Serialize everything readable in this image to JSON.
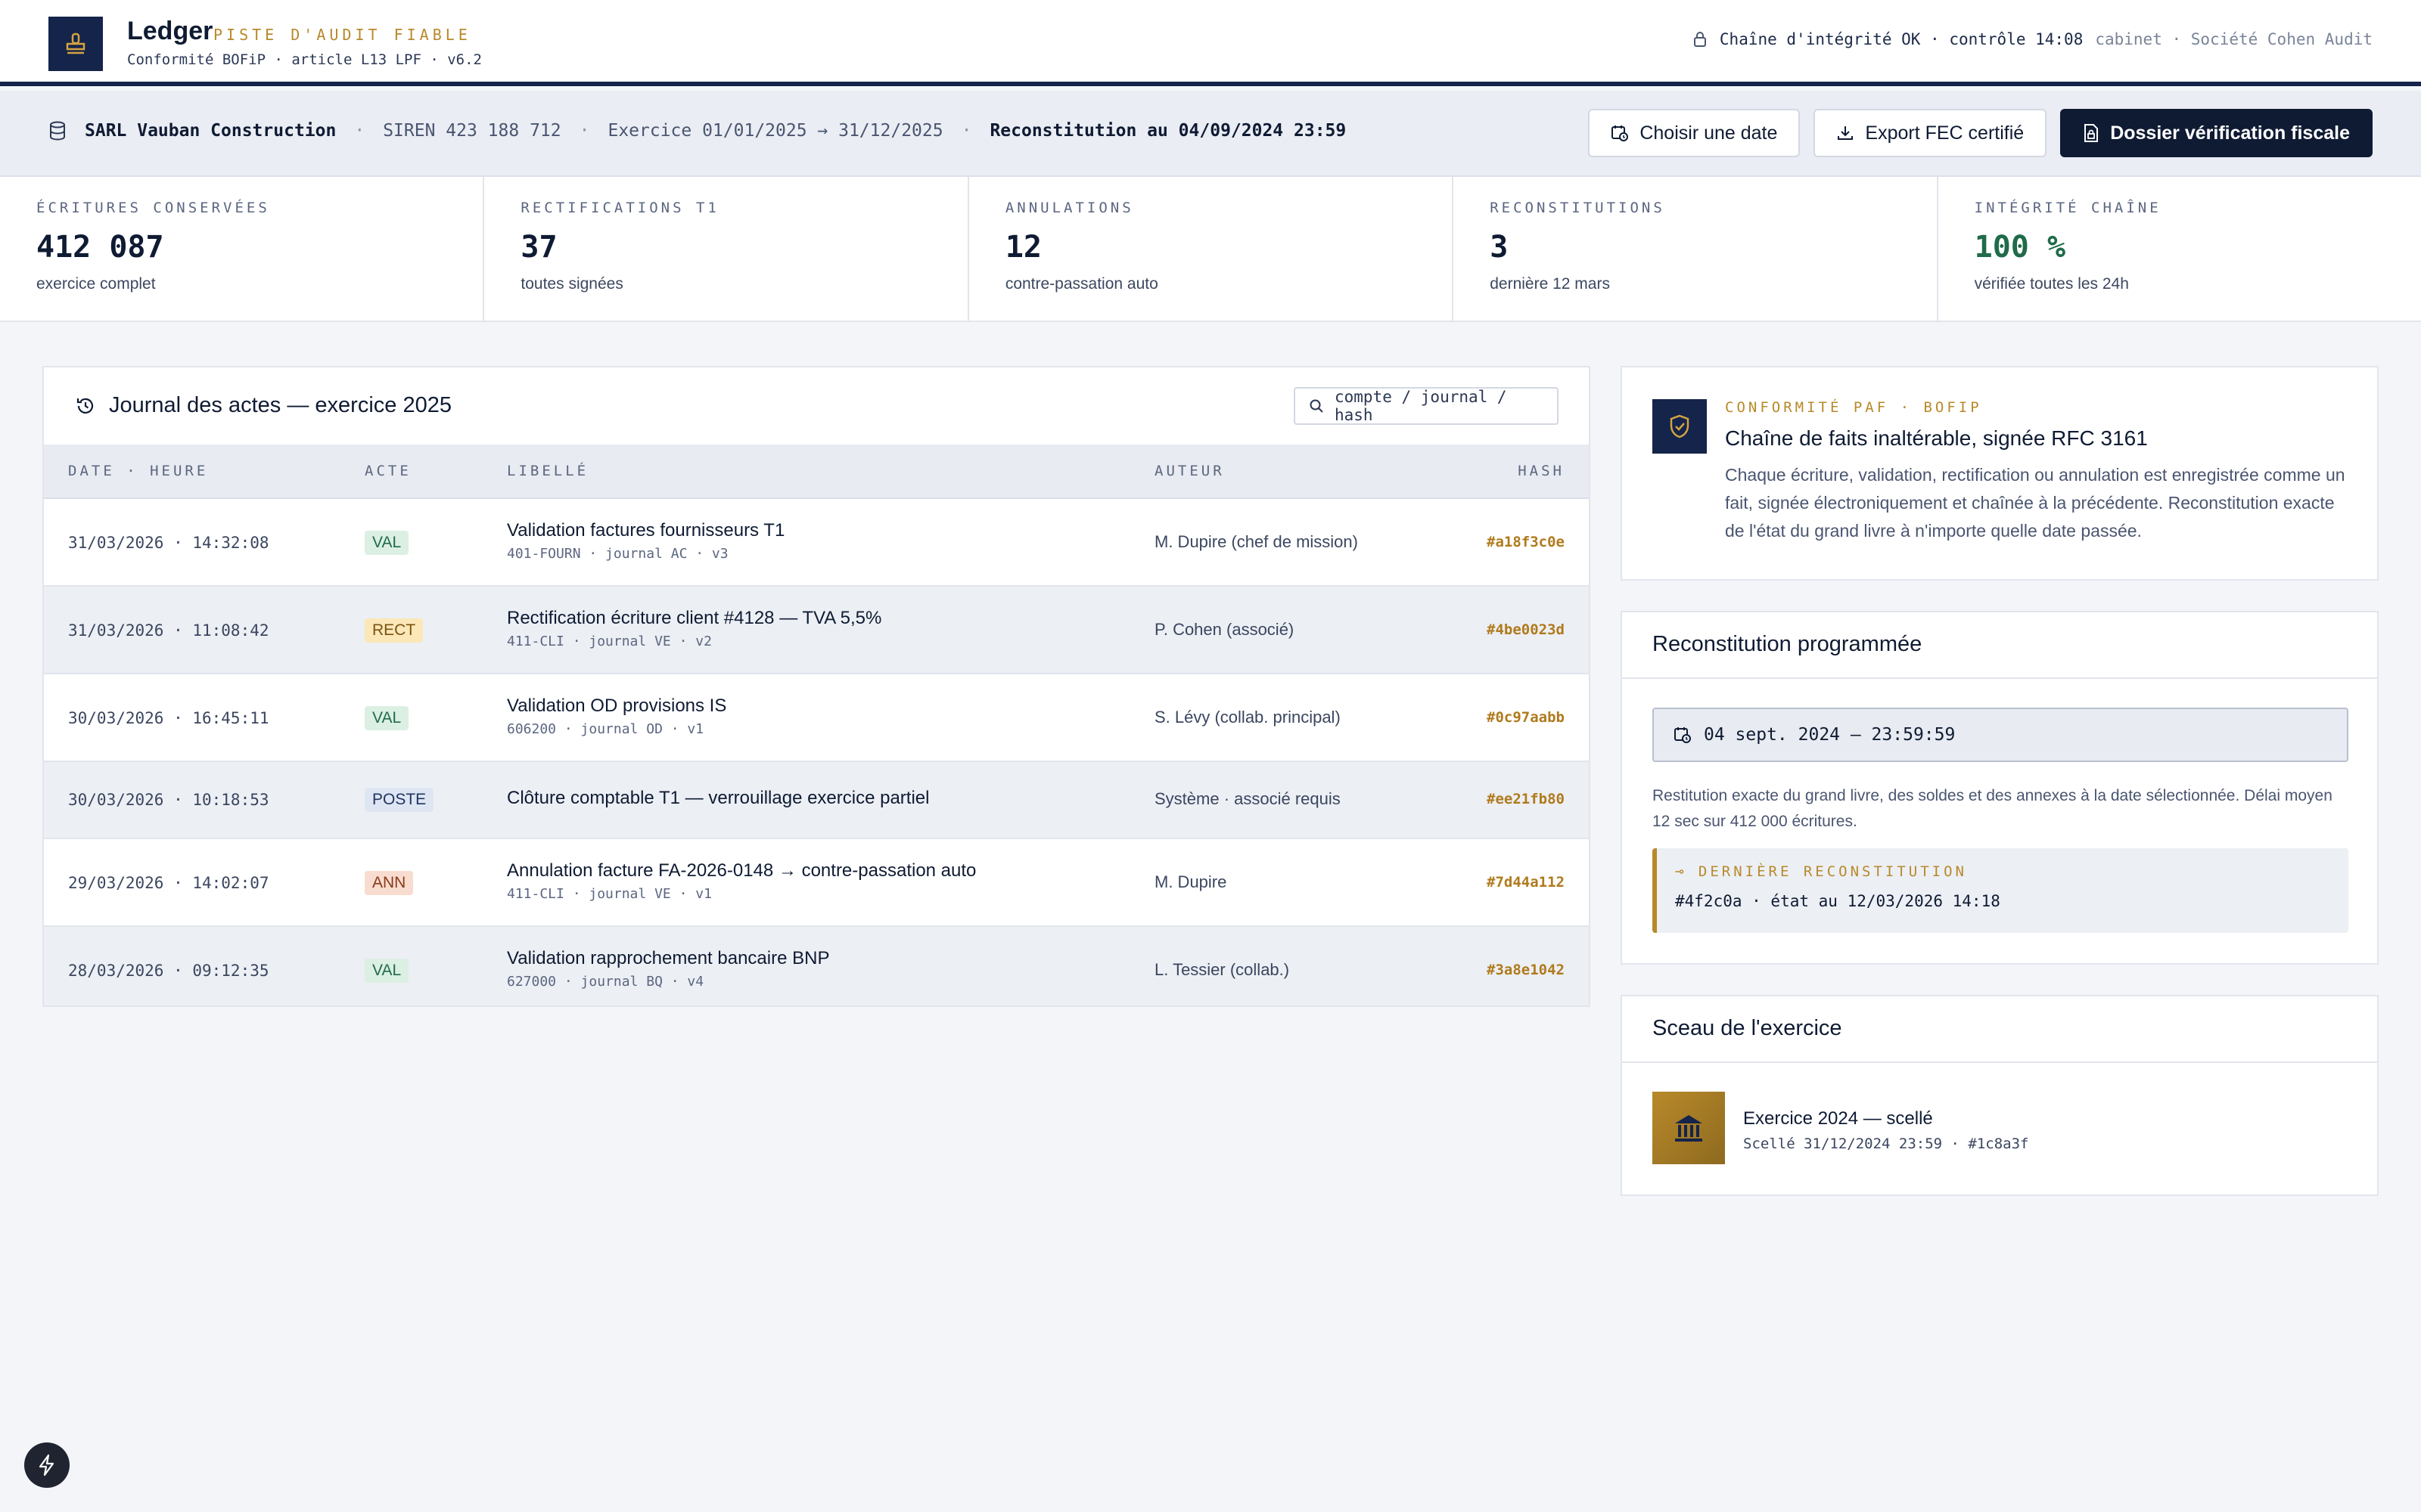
{
  "header": {
    "brand": "Ledger",
    "tagline": "PISTE D'AUDIT FIABLE",
    "subtitle": "Conformité BOFiP · article L13 LPF · v6.2",
    "integrity_status": "Chaîne d'intégrité OK · contrôle 14:08",
    "firm": "cabinet · Société Cohen Audit"
  },
  "context": {
    "company": "SARL Vauban Construction",
    "siren": "SIREN 423 188 712",
    "exercise": "Exercice 01/01/2025 → 31/12/2025",
    "reconstitution": "Reconstitution au 04/09/2024 23:59",
    "actions": {
      "choose_date": "Choisir une date",
      "export_fec": "Export FEC certifié",
      "tax_audit": "Dossier vérification fiscale"
    }
  },
  "kpis": [
    {
      "label": "ÉCRITURES CONSERVÉES",
      "value": "412 087",
      "note": "exercice complet"
    },
    {
      "label": "RECTIFICATIONS T1",
      "value": "37",
      "note": "toutes signées"
    },
    {
      "label": "ANNULATIONS",
      "value": "12",
      "note": "contre-passation auto"
    },
    {
      "label": "RECONSTITUTIONS",
      "value": "3",
      "note": "dernière 12 mars"
    },
    {
      "label": "INTÉGRITÉ CHAÎNE",
      "value": "100 %",
      "note": "vérifiée toutes les 24h"
    }
  ],
  "journal": {
    "title": "Journal des actes — exercice 2025",
    "search_placeholder": "compte / journal / hash",
    "columns": {
      "date": "DATE · HEURE",
      "act": "ACTE",
      "label": "LIBELLÉ",
      "author": "AUTEUR",
      "hash": "HASH"
    },
    "rows": [
      {
        "date": "31/03/2026 · 14:32:08",
        "act": "VAL",
        "label": "Validation factures fournisseurs T1",
        "sub": "401-FOURN · journal AC · v3",
        "author": "M. Dupire (chef de mission)",
        "hash": "#a18f3c0e"
      },
      {
        "date": "31/03/2026 · 11:08:42",
        "act": "RECT",
        "label": "Rectification écriture client #4128 — TVA 5,5%",
        "sub": "411-CLI · journal VE · v2",
        "author": "P. Cohen (associé)",
        "hash": "#4be0023d"
      },
      {
        "date": "30/03/2026 · 16:45:11",
        "act": "VAL",
        "label": "Validation OD provisions IS",
        "sub": "606200 · journal OD · v1",
        "author": "S. Lévy (collab. principal)",
        "hash": "#0c97aabb"
      },
      {
        "date": "30/03/2026 · 10:18:53",
        "act": "POSTE",
        "label": "Clôture comptable T1 — verrouillage exercice partiel",
        "sub": "",
        "author": "Système · associé requis",
        "hash": "#ee21fb80"
      },
      {
        "date": "29/03/2026 · 14:02:07",
        "act": "ANN",
        "label": "Annulation facture FA-2026-0148 → contre-passation auto",
        "sub": "411-CLI · journal VE · v1",
        "author": "M. Dupire",
        "hash": "#7d44a112"
      },
      {
        "date": "28/03/2026 · 09:12:35",
        "act": "VAL",
        "label": "Validation rapprochement bancaire BNP",
        "sub": "627000 · journal BQ · v4",
        "author": "L. Tessier (collab.)",
        "hash": "#3a8e1042"
      }
    ]
  },
  "compliance": {
    "tag": "CONFORMITÉ PAF · BOFIP",
    "title": "Chaîne de faits inaltérable, signée RFC 3161",
    "text": "Chaque écriture, validation, rectification ou annulation est enregistrée comme un fait, signée électroniquement et chaînée à la précédente. Reconstitution exacte de l'état du grand livre à n'importe quelle date passée."
  },
  "reconstitution": {
    "title": "Reconstitution programmée",
    "date_value": "04 sept. 2024 — 23:59:59",
    "text": "Restitution exacte du grand livre, des soldes et des annexes à la date sélectionnée. Délai moyen 12 sec sur 412 000 écritures.",
    "last_label": "⊸ DERNIÈRE RECONSTITUTION",
    "last_value": "#4f2c0a · état au 12/03/2026 14:18"
  },
  "seal": {
    "title": "Sceau de l'exercice",
    "item_title": "Exercice 2024 — scellé",
    "item_sub": "Scellé 31/12/2024 23:59 · #1c8a3f"
  },
  "icons": {
    "logo": "stamp-icon",
    "lock": "lock-icon",
    "database": "database-icon",
    "calendar": "calendar-clock-icon",
    "download": "download-icon",
    "file": "file-lock-icon",
    "history": "history-icon",
    "search": "search-icon",
    "shield": "shield-check-icon",
    "bank": "bank-icon",
    "bolt": "bolt-icon"
  },
  "colors": {
    "navy": "#14244a",
    "gold": "#b8892a",
    "green": "#1f6b4a"
  }
}
